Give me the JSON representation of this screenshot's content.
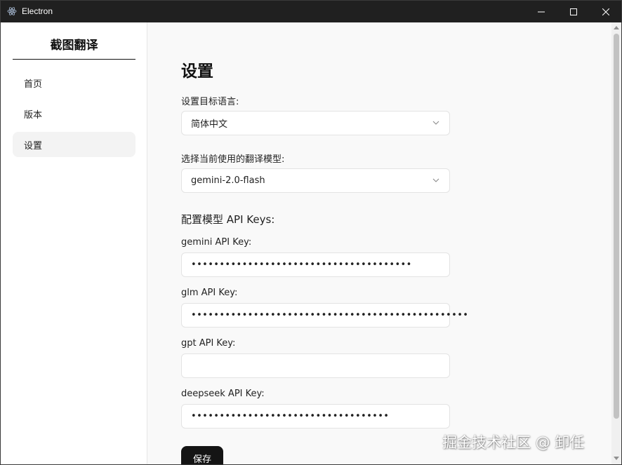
{
  "window": {
    "title": "Electron",
    "icon": "electron-icon"
  },
  "sidebar": {
    "brand": "截图翻译",
    "items": [
      {
        "label": "首页",
        "active": false
      },
      {
        "label": "版本",
        "active": false
      },
      {
        "label": "设置",
        "active": true
      }
    ]
  },
  "main": {
    "title": "设置",
    "target_language": {
      "label": "设置目标语言:",
      "value": "简体中文"
    },
    "model": {
      "label": "选择当前使用的翻译模型:",
      "value": "gemini-2.0-flash"
    },
    "api_section_title": "配置模型 API Keys:",
    "keys": [
      {
        "label": "gemini API Key:",
        "value": "•••••••••••••••••••••••••••••••••••••••"
      },
      {
        "label": "glm API Key:",
        "value": "•••••••••••••••••••••••••••••••••••••••••••••••••"
      },
      {
        "label": "gpt API Key:",
        "value": ""
      },
      {
        "label": "deepseek API Key:",
        "value": "•••••••••••••••••••••••••••••••••••"
      }
    ],
    "save_label": "保存"
  },
  "watermark": "掘金技术社区 @ 卸任",
  "colors": {
    "titlebar": "#202020",
    "content_bg": "#f9f9f9",
    "button": "#141414"
  }
}
